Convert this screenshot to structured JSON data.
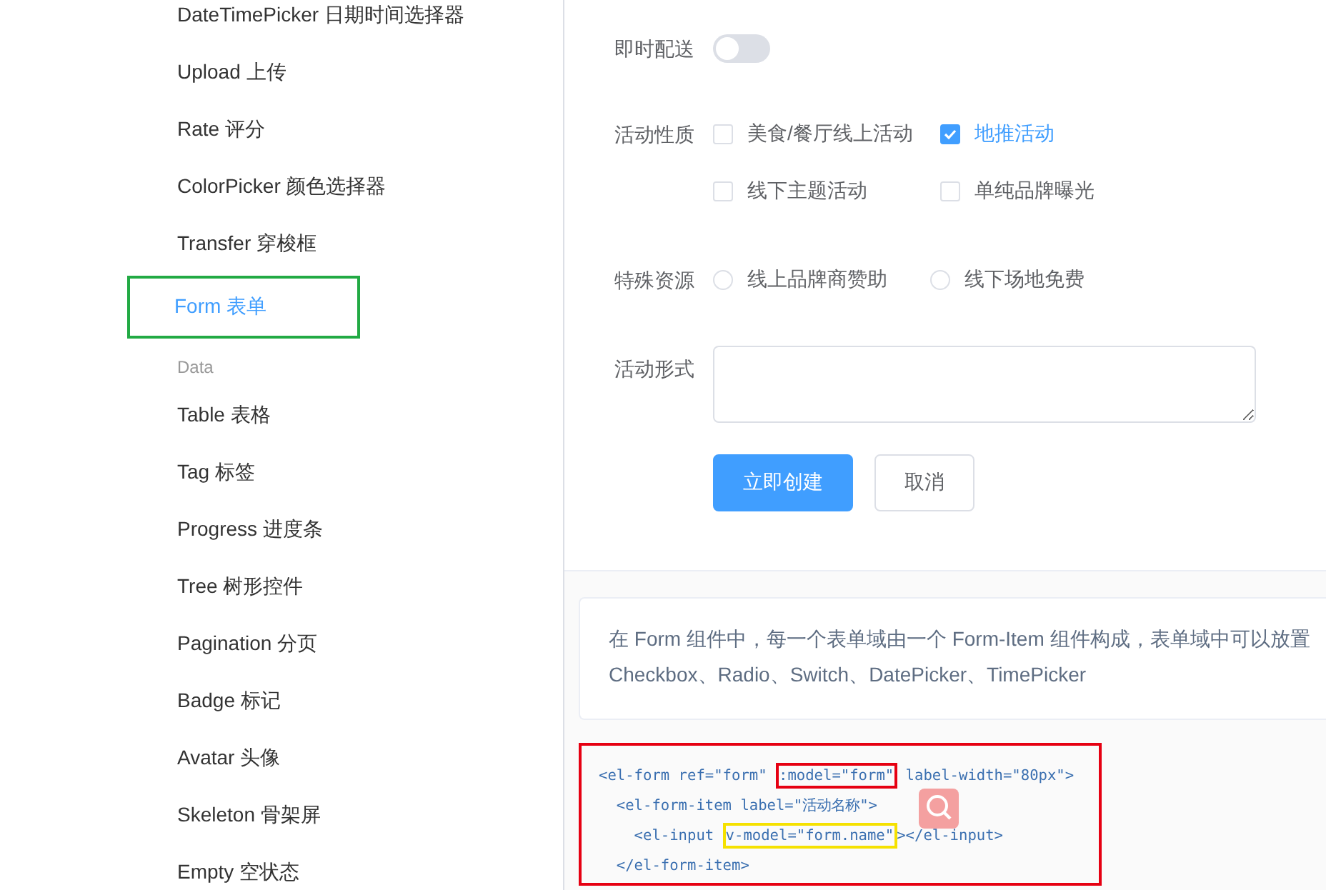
{
  "sidebar": {
    "items": [
      {
        "kind": "item",
        "label": "DateTimePicker 日期时间选择器",
        "selected": false,
        "outlined": false
      },
      {
        "kind": "item",
        "label": "Upload 上传",
        "selected": false,
        "outlined": false
      },
      {
        "kind": "item",
        "label": "Rate 评分",
        "selected": false,
        "outlined": false
      },
      {
        "kind": "item",
        "label": "ColorPicker 颜色选择器",
        "selected": false,
        "outlined": false
      },
      {
        "kind": "item",
        "label": "Transfer 穿梭框",
        "selected": false,
        "outlined": false
      },
      {
        "kind": "item",
        "label": "Form 表单",
        "selected": true,
        "outlined": true
      },
      {
        "kind": "group",
        "label": "Data"
      },
      {
        "kind": "item",
        "label": "Table 表格",
        "selected": false,
        "outlined": false
      },
      {
        "kind": "item",
        "label": "Tag 标签",
        "selected": false,
        "outlined": false
      },
      {
        "kind": "item",
        "label": "Progress 进度条",
        "selected": false,
        "outlined": false
      },
      {
        "kind": "item",
        "label": "Tree 树形控件",
        "selected": false,
        "outlined": false
      },
      {
        "kind": "item",
        "label": "Pagination 分页",
        "selected": false,
        "outlined": false
      },
      {
        "kind": "item",
        "label": "Badge 标记",
        "selected": false,
        "outlined": false
      },
      {
        "kind": "item",
        "label": "Avatar 头像",
        "selected": false,
        "outlined": false
      },
      {
        "kind": "item",
        "label": "Skeleton 骨架屏",
        "selected": false,
        "outlined": false
      },
      {
        "kind": "item",
        "label": "Empty 空状态",
        "selected": false,
        "outlined": false
      }
    ]
  },
  "form": {
    "rows": [
      {
        "kind": "switch",
        "label": "即时配送",
        "on": false
      },
      {
        "kind": "checkboxes",
        "label": "活动性质",
        "options": [
          {
            "label": "美食/餐厅线上活动",
            "checked": false
          },
          {
            "label": "地推活动",
            "checked": true
          },
          {
            "label": "线下主题活动",
            "checked": false
          },
          {
            "label": "单纯品牌曝光",
            "checked": false
          }
        ]
      },
      {
        "kind": "radios",
        "label": "特殊资源",
        "options": [
          {
            "label": "线上品牌商赞助",
            "selected": false
          },
          {
            "label": "线下场地免费",
            "selected": false
          }
        ]
      },
      {
        "kind": "textarea",
        "label": "活动形式"
      }
    ],
    "buttons": [
      {
        "label": "立即创建",
        "kind": "primary"
      },
      {
        "label": "取消",
        "kind": "plain"
      }
    ]
  },
  "description": {
    "lines": [
      "在 Form 组件中，每一个表单域由一个 Form-Item 组件构成，表单域中可以放置",
      "Checkbox、Radio、Switch、DatePicker、TimePicker"
    ]
  },
  "code": {
    "lines": [
      [
        {
          "text": "<el-form ref=\"form\" "
        },
        {
          "text": ":model=\"form\"",
          "color": "#e60012"
        },
        {
          "text": " label-width=\"80px\">"
        }
      ],
      [
        {
          "text": "  <el-form-item label=\"活动名称\">"
        }
      ],
      [
        {
          "text": "    <el-input "
        },
        {
          "text": "v-model=\"form.name\"",
          "color": "#f5e100"
        },
        {
          "text": "></el-input>"
        }
      ],
      [
        {
          "text": "  </el-form-item>"
        }
      ]
    ]
  }
}
